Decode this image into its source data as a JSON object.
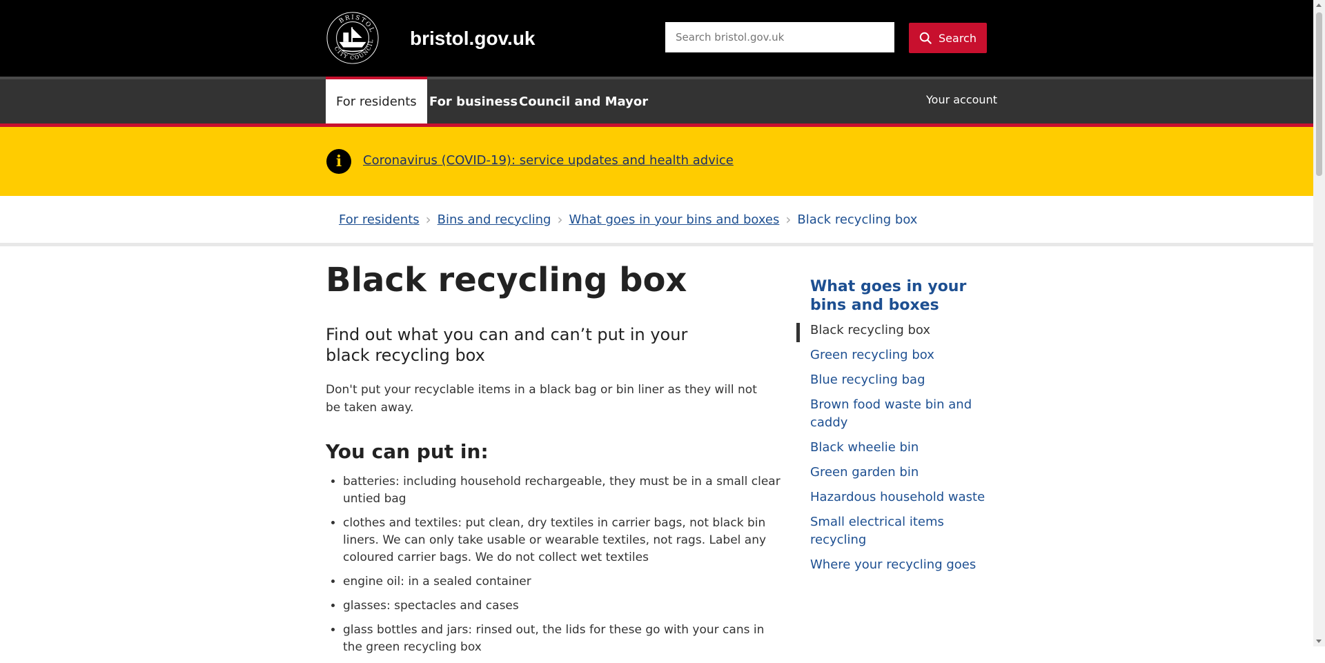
{
  "header": {
    "site_name": "bristol.gov.uk",
    "logo_text_top": "BRISTOL",
    "logo_text_bottom": "CITY COUNCIL",
    "search_placeholder": "Search bristol.gov.uk",
    "search_label": "Search"
  },
  "nav": {
    "tabs": [
      {
        "label": "For residents",
        "active": true
      },
      {
        "label": "For business",
        "active": false
      },
      {
        "label": "Council and Mayor",
        "active": false
      }
    ],
    "account_label": "Your account"
  },
  "banner": {
    "link_text": "Coronavirus (COVID-19): service updates and health advice"
  },
  "breadcrumb": {
    "items": [
      "For residents",
      "Bins and recycling",
      "What goes in your bins and boxes"
    ],
    "current": "Black recycling box"
  },
  "main": {
    "title": "Black recycling box",
    "lede": "Find out what you can and can’t put in your black recycling box",
    "intro": "Don't put your recyclable items in a black bag or bin liner as they will not be taken away.",
    "put_in_heading": "You can put in:",
    "put_in_items": [
      "batteries: including household rechargeable, they must be in a small clear untied bag",
      "clothes and textiles: put clean, dry textiles in carrier bags, not black bin liners. We can only take usable or wearable textiles, not rags. Label any coloured carrier bags. We do not collect wet textiles",
      "engine oil: in a sealed container",
      "glasses: spectacles and cases",
      "glass bottles and jars: rinsed out, the lids for these go with your cans in the green recycling box"
    ]
  },
  "sidebar": {
    "title": "What goes in your bins and boxes",
    "items": [
      {
        "label": "Black recycling box",
        "current": true
      },
      {
        "label": "Green recycling box",
        "current": false
      },
      {
        "label": "Blue recycling bag",
        "current": false
      },
      {
        "label": "Brown food waste bin and caddy",
        "current": false
      },
      {
        "label": "Black wheelie bin",
        "current": false
      },
      {
        "label": "Green garden bin",
        "current": false
      },
      {
        "label": "Hazardous household waste",
        "current": false
      },
      {
        "label": "Small electrical items recycling",
        "current": false
      },
      {
        "label": "Where your recycling goes",
        "current": false
      }
    ]
  },
  "colors": {
    "header_bg": "#000000",
    "nav_bg": "#333333",
    "accent_red": "#c8102e",
    "banner_yellow": "#ffcc00",
    "link_blue": "#1d4f91"
  }
}
